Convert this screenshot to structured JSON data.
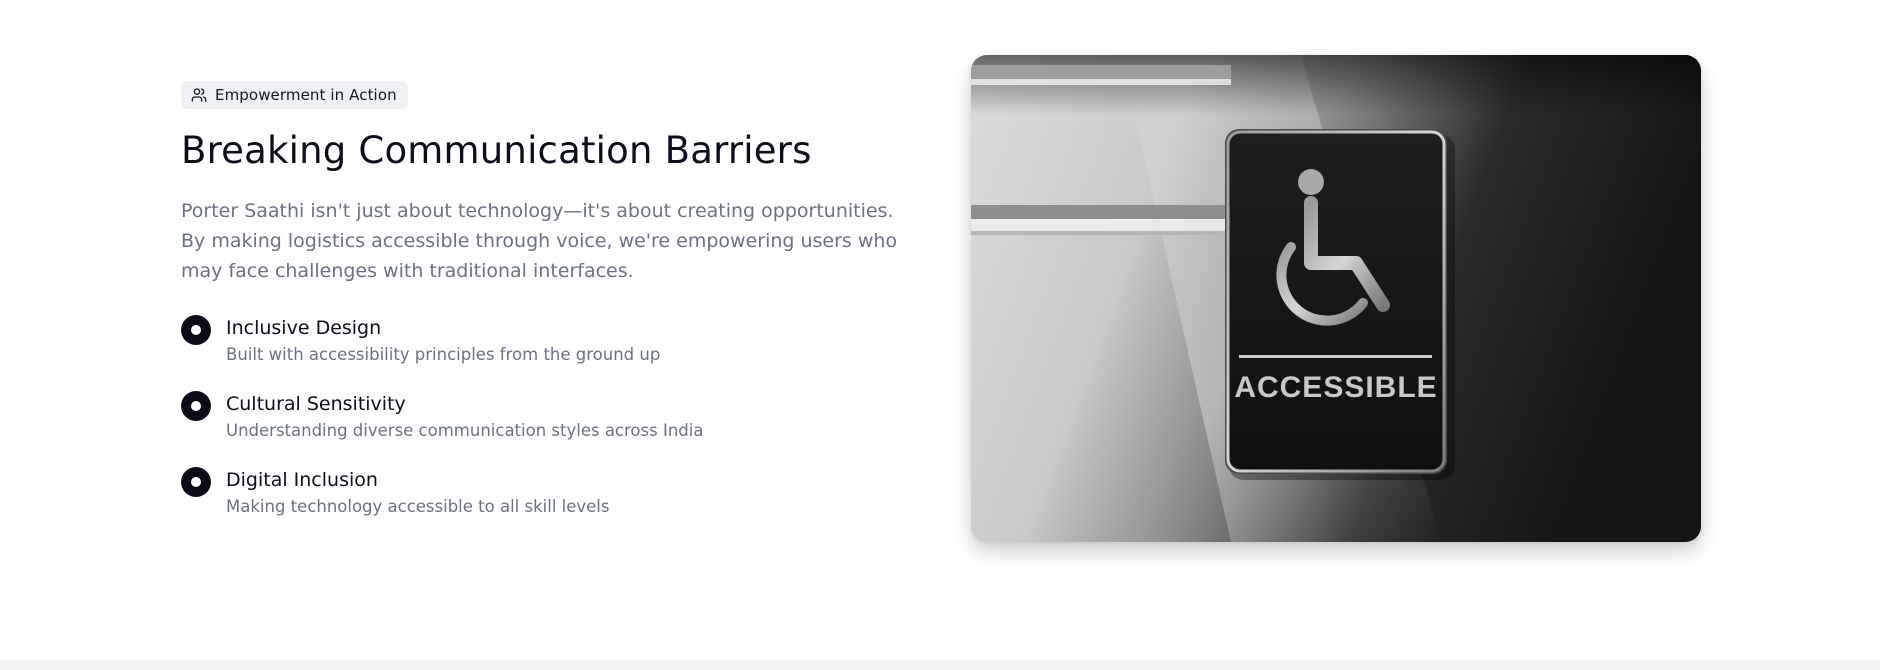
{
  "badge": {
    "icon": "users-icon",
    "label": "Empowerment in Action"
  },
  "title": "Breaking Communication Barriers",
  "description": "Porter Saathi isn't just about technology—it's about creating opportunities. By making logistics accessible through voice, we're empowering users who may face challenges with traditional interfaces.",
  "features": [
    {
      "title": "Inclusive Design",
      "description": "Built with accessibility principles from the ground up"
    },
    {
      "title": "Cultural Sensitivity",
      "description": "Understanding diverse communication styles across India"
    },
    {
      "title": "Digital Inclusion",
      "description": "Making technology accessible to all skill levels"
    }
  ],
  "image": {
    "sign_text": "ACCESSIBLE",
    "icon": "wheelchair-icon"
  },
  "colors": {
    "accent_dark": "#0b0b18",
    "muted_text": "#6b7280",
    "badge_bg": "#eef0f3"
  }
}
